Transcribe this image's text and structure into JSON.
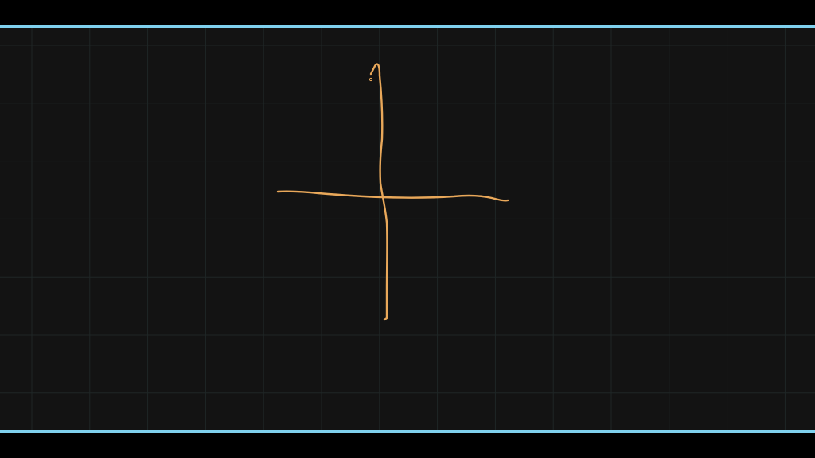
{
  "colors": {
    "background": "#131313",
    "grid_line": "#1f2626",
    "frame_accent": "#7fd0ee",
    "letterbox": "#000000",
    "stroke": "#e9a85a"
  },
  "canvas": {
    "grid_visible": true,
    "tool": "pen",
    "drawing_description_icon": "cross-shaped-freehand-stroke"
  }
}
